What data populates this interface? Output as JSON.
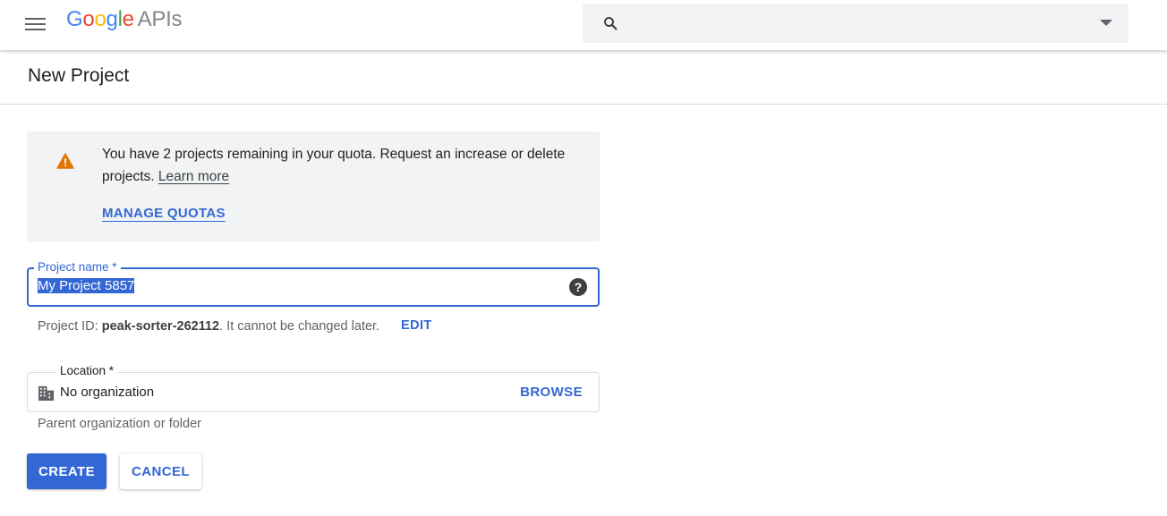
{
  "header": {
    "logo": {
      "google": "Google",
      "apis": "APIs"
    },
    "search": {
      "placeholder": "",
      "value": ""
    }
  },
  "page": {
    "title": "New Project"
  },
  "notice": {
    "text": "You have 2 projects remaining in your quota. Request an increase or delete projects.",
    "learn_more": "Learn more",
    "manage_quotas": "MANAGE QUOTAS"
  },
  "project_name": {
    "label": "Project name *",
    "value": "My Project 5857"
  },
  "project_id": {
    "prefix": "Project ID:",
    "id": "peak-sorter-262112",
    "suffix": ". It cannot be changed later.",
    "edit": "EDIT"
  },
  "location": {
    "label": "Location *",
    "value": "No organization",
    "browse": "BROWSE",
    "helper": "Parent organization or folder"
  },
  "actions": {
    "create": "CREATE",
    "cancel": "CANCEL"
  },
  "colors": {
    "primary": "#3367d6",
    "warning": "#e37400",
    "notice_bg": "#f1f3f4"
  }
}
